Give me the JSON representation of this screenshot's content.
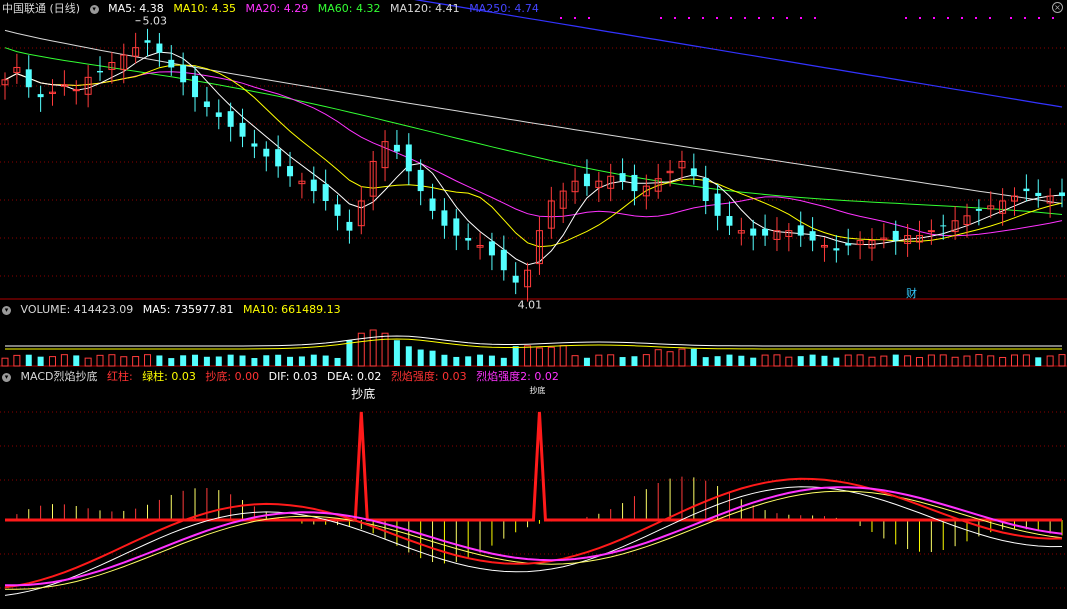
{
  "header": {
    "title": "中国联通 (日线)",
    "ma": [
      {
        "label": "MA5: 4.38",
        "color": "#ffffff"
      },
      {
        "label": "MA10: 4.35",
        "color": "#ffff00"
      },
      {
        "label": "MA20: 4.29",
        "color": "#ff33ff"
      },
      {
        "label": "MA60: 4.32",
        "color": "#33ff33"
      },
      {
        "label": "MA120: 4.41",
        "color": "#d9d9d9"
      },
      {
        "label": "MA250: 4.74",
        "color": "#3333ff"
      }
    ]
  },
  "price": {
    "high_label": "5.03",
    "low_label": "4.01",
    "marker": "财"
  },
  "volume_header": {
    "volume": "VOLUME: 414423.09",
    "ma5": "MA5: 735977.81",
    "ma10": "MA10: 661489.13"
  },
  "macd_header": {
    "name": "MACD烈焰抄底",
    "red": "红柱: ",
    "green": "绿柱: 0.03",
    "bottom": "抄底: 0.00",
    "dif": "DIF: 0.03",
    "dea": "DEA: 0.02",
    "s1": "烈焰强度: 0.03",
    "s2": "烈焰强度2: 0.02"
  },
  "macd_marks": [
    "抄底",
    "抄底"
  ],
  "colors": {
    "up": "#ff3b3b",
    "down": "#54ffff",
    "grid": "#8b0000",
    "ma5": "#ffffff",
    "ma10": "#ffff00",
    "ma20": "#ff33ff",
    "ma60": "#33ff33",
    "ma120": "#d9d9d9",
    "ma250": "#3333ff"
  },
  "chart_data": {
    "type": "candlestick",
    "x_count": 90,
    "price_range": [
      4.0,
      5.1
    ],
    "close": [
      4.85,
      4.9,
      4.82,
      4.78,
      4.8,
      4.83,
      4.81,
      4.86,
      4.88,
      4.92,
      4.95,
      4.98,
      5.0,
      4.96,
      4.9,
      4.84,
      4.78,
      4.74,
      4.7,
      4.66,
      4.62,
      4.58,
      4.54,
      4.5,
      4.46,
      4.44,
      4.4,
      4.36,
      4.3,
      4.24,
      4.36,
      4.52,
      4.6,
      4.56,
      4.48,
      4.4,
      4.32,
      4.26,
      4.22,
      4.2,
      4.18,
      4.14,
      4.08,
      4.03,
      4.08,
      4.24,
      4.36,
      4.4,
      4.44,
      4.42,
      4.44,
      4.46,
      4.44,
      4.4,
      4.42,
      4.45,
      4.48,
      4.52,
      4.46,
      4.36,
      4.3,
      4.26,
      4.24,
      4.22,
      4.22,
      4.24,
      4.24,
      4.22,
      4.2,
      4.18,
      4.16,
      4.18,
      4.2,
      4.2,
      4.21,
      4.2,
      4.22,
      4.22,
      4.24,
      4.26,
      4.28,
      4.3,
      4.32,
      4.34,
      4.36,
      4.38,
      4.4,
      4.38,
      4.38,
      4.38
    ],
    "ma250_start": 5.45,
    "ma250_end": 4.74,
    "volume_range": [
      0,
      1600000
    ],
    "macd_range": [
      -0.6,
      0.5
    ]
  }
}
